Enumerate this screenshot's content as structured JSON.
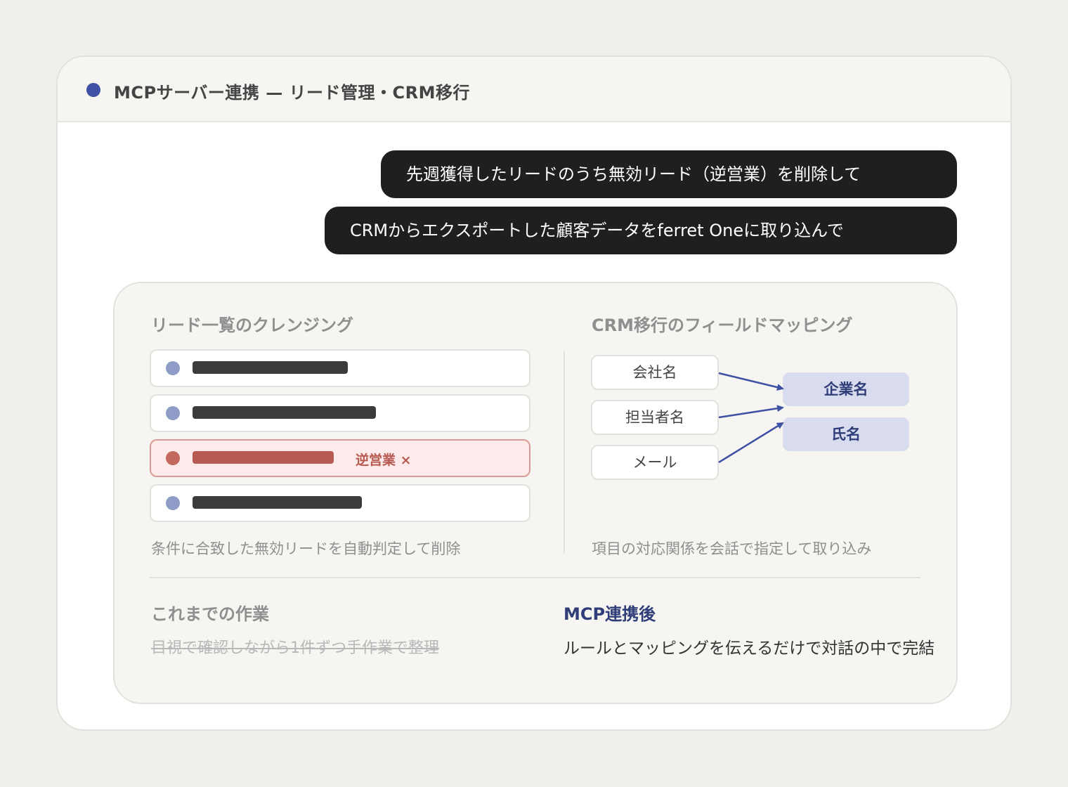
{
  "header": {
    "title": "MCPサーバー連携 — リード管理・CRM移行",
    "accent_color": "#3f51a3"
  },
  "chat": {
    "messages": [
      "先週獲得したリードのうち無効リード（逆営業）を削除して",
      "CRMからエクスポートした顧客データをferret Oneに取り込んで"
    ]
  },
  "cleansing": {
    "title": "リード一覧のクレンジング",
    "rows": [
      {
        "status": "valid"
      },
      {
        "status": "valid"
      },
      {
        "status": "invalid",
        "tag": "逆営業 ×"
      },
      {
        "status": "valid"
      }
    ],
    "caption": "条件に合致した無効リードを自動判定して削除"
  },
  "mapping": {
    "title": "CRM移行のフィールドマッピング",
    "source_fields": [
      "会社名",
      "担当者名",
      "メール"
    ],
    "target_fields": [
      "企業名",
      "氏名"
    ],
    "links": [
      {
        "from": "会社名",
        "to": "企業名"
      },
      {
        "from": "担当者名",
        "to": "企業名"
      },
      {
        "from": "メール",
        "to": "氏名"
      }
    ],
    "caption": "項目の対応関係を会話で指定して取り込み"
  },
  "comparison": {
    "before_title": "これまでの作業",
    "before_text": "目視で確認しながら1件ずつ手作業で整理",
    "after_title": "MCP連携後",
    "after_text": "ルールとマッピングを伝えるだけで対話の中で完結"
  },
  "colors": {
    "valid_dot": "#8f9cc8",
    "invalid_row": "#fdeaea",
    "invalid_accent": "#b75a52",
    "target_field_bg": "#d8dcee",
    "arrow": "#3f51a3"
  }
}
